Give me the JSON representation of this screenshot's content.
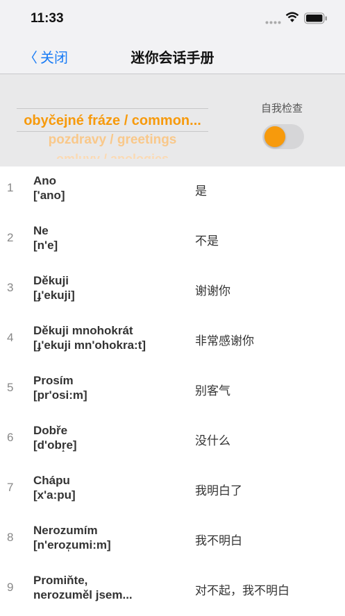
{
  "status_bar": {
    "time": "11:33"
  },
  "nav": {
    "back_label": "关闭",
    "title": "迷你会话手册"
  },
  "category_picker": {
    "selected": "obyčejné fráze / common...",
    "next": "pozdravy / greetings",
    "next2": "omluvy / apologies"
  },
  "self_check": {
    "label": "自我检查",
    "on": false
  },
  "colors": {
    "accent": "#f79a0c",
    "link": "#1a7cf5"
  },
  "phrases": [
    {
      "num": "1",
      "word": "Ano",
      "pron": "['ano]",
      "translation": "是"
    },
    {
      "num": "2",
      "word": "Ne",
      "pron": "[n'e]",
      "translation": "不是"
    },
    {
      "num": "3",
      "word": "Děkuji",
      "pron": "[ɟ'ekuji]",
      "translation": "谢谢你"
    },
    {
      "num": "4",
      "word": "Děkuji mnohokrát",
      "pron": "[ɟ'ekuji mn'ohokra:t]",
      "translation": "非常感谢你"
    },
    {
      "num": "5",
      "word": "Prosím",
      "pron": "[pr'osi:m]",
      "translation": "别客气"
    },
    {
      "num": "6",
      "word": "Dobře",
      "pron": "[d'obr̝e]",
      "translation": "没什么"
    },
    {
      "num": "7",
      "word": "Chápu",
      "pron": "[x'a:pu]",
      "translation": "我明白了"
    },
    {
      "num": "8",
      "word": "Nerozumím",
      "pron": "[n'eroz̩umi:m]",
      "translation": "我不明白"
    },
    {
      "num": "9",
      "word": "Promiňte,",
      "pron": "nerozuměl jsem...",
      "translation": "对不起，我不明白"
    }
  ]
}
